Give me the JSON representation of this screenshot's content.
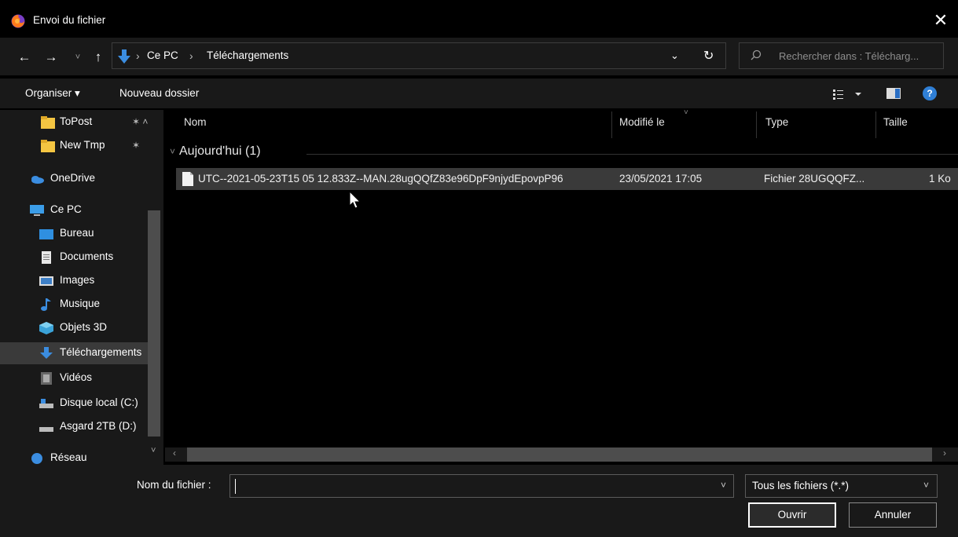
{
  "window": {
    "title": "Envoi du fichier",
    "close_glyph": "✕"
  },
  "nav": {
    "back_glyph": "←",
    "forward_glyph": "→",
    "recent_glyph": "˅",
    "up_glyph": "↑"
  },
  "address": {
    "sep": "›",
    "crumbs": [
      "Ce PC",
      "Téléchargements"
    ],
    "dropdown_glyph": "⌄",
    "refresh_glyph": "↻"
  },
  "search": {
    "placeholder": "Rechercher dans : Télécharg..."
  },
  "toolbar": {
    "organize_label": "Organiser ▾",
    "new_folder_label": "Nouveau dossier",
    "help_label": "?"
  },
  "sidebar": {
    "items": [
      {
        "label": "ToPost",
        "icon": "folder-icon"
      },
      {
        "label": "New Tmp",
        "icon": "folder-icon"
      },
      {
        "label": "OneDrive",
        "icon": "cloud-icon"
      },
      {
        "label": "Ce PC",
        "icon": "computer-icon"
      },
      {
        "label": "Bureau",
        "icon": "desktop-icon"
      },
      {
        "label": "Documents",
        "icon": "documents-icon"
      },
      {
        "label": "Images",
        "icon": "images-icon"
      },
      {
        "label": "Musique",
        "icon": "music-icon"
      },
      {
        "label": "Objets 3D",
        "icon": "cube-icon"
      },
      {
        "label": "Téléchargements",
        "icon": "download-icon",
        "selected": true
      },
      {
        "label": "Vidéos",
        "icon": "video-icon"
      },
      {
        "label": "Disque local (C:)",
        "icon": "drive-icon"
      },
      {
        "label": "Asgard 2TB (D:)",
        "icon": "drive-icon"
      },
      {
        "label": "Réseau",
        "icon": "network-icon"
      }
    ],
    "pin_glyph": "📌"
  },
  "columns": {
    "name": "Nom",
    "modified": "Modifié le",
    "type": "Type",
    "size": "Taille"
  },
  "group": {
    "label": "Aujourd'hui (1)"
  },
  "files": [
    {
      "name": "UTC--2021-05-23T15 05 12.833Z--MAN.28ugQQfZ83e96DpF9njydEpovpP96",
      "modified": "23/05/2021 17:05",
      "type": "Fichier 28UGQQFZ...",
      "size": "1 Ko"
    }
  ],
  "bottom": {
    "filename_label": "Nom du fichier :",
    "filename_value": "",
    "filetype_value": "Tous les fichiers (*.*)",
    "open_label": "Ouvrir",
    "cancel_label": "Annuler"
  },
  "colors": {
    "background": "#000000",
    "panel": "#191919",
    "selection": "#3a3a3a",
    "accent_blue": "#2f7fd6",
    "folder_yellow": "#f4c542"
  }
}
